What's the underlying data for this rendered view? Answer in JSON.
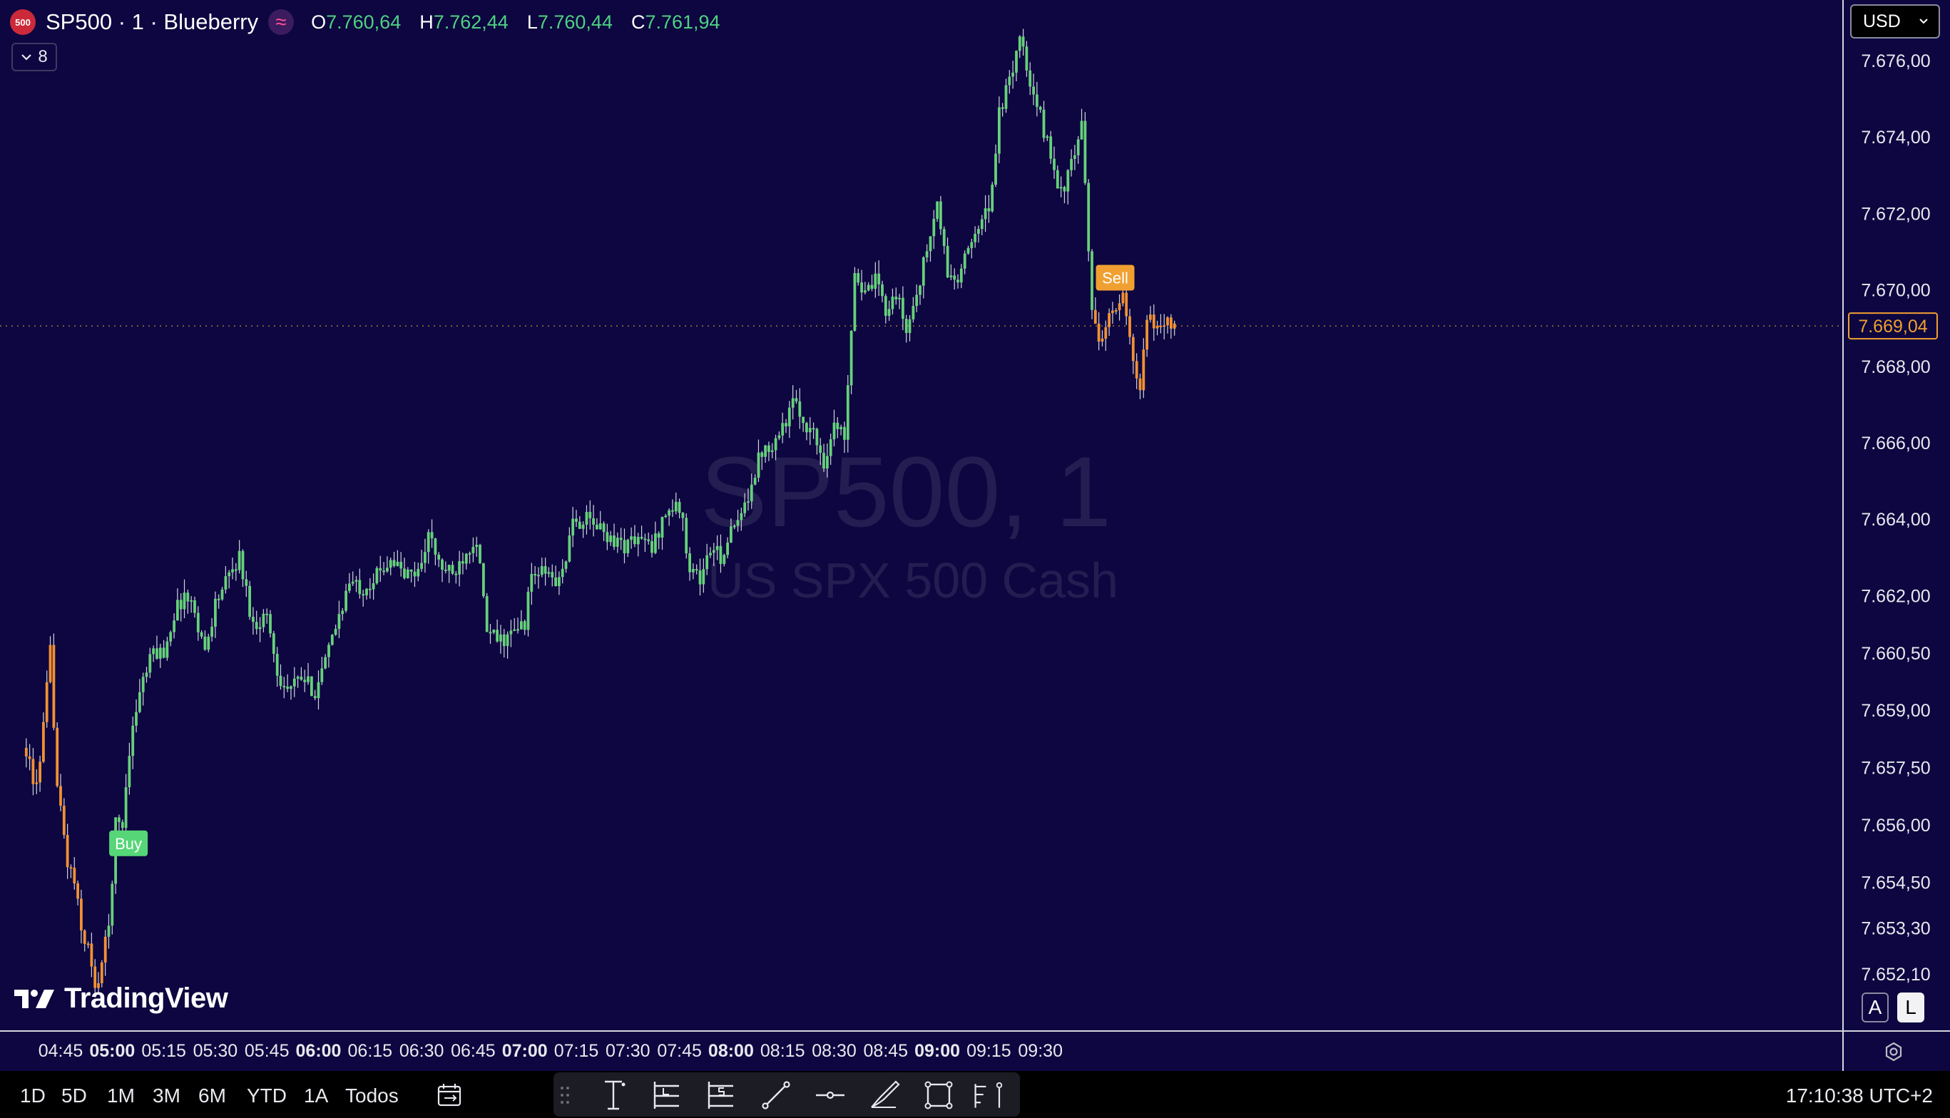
{
  "header": {
    "symbol_logo_text": "500",
    "title": "SP500 · 1 · Blueberry",
    "ohlc": [
      {
        "key": "O",
        "value": "7.760,64"
      },
      {
        "key": "H",
        "value": "7.762,44"
      },
      {
        "key": "L",
        "value": "7.760,44"
      },
      {
        "key": "C",
        "value": "7.761,94"
      }
    ],
    "indicator_count": "8"
  },
  "currency": {
    "label": "USD"
  },
  "watermark": {
    "line1": "SP500, 1",
    "line2": "US SPX 500 Cash"
  },
  "logo": {
    "text": "TradingView"
  },
  "scale_buttons": {
    "auto": "A",
    "log": "L"
  },
  "ranges": [
    "1D",
    "5D",
    "1M",
    "3M",
    "6M",
    "YTD",
    "1A",
    "Todos"
  ],
  "clock": "17:10:38 UTC+2",
  "colors": {
    "background": "#0d0640",
    "up": "#66d17a",
    "down": "#f19133",
    "wick": "#cfd6dd",
    "accent": "#f0a030",
    "buy": "#56d677"
  },
  "tools": [
    "drag-handle-icon",
    "cursor-text-icon",
    "long-position-icon",
    "short-position-icon",
    "trend-line-icon",
    "horizontal-ray-icon",
    "brush-icon",
    "rectangle-icon",
    "fib-icon"
  ],
  "chart_data": {
    "type": "candlestick",
    "x_ticks": [
      {
        "label": "04:45",
        "t": 0,
        "bold": false
      },
      {
        "label": "05:00",
        "t": 15,
        "bold": true
      },
      {
        "label": "05:15",
        "t": 30,
        "bold": false
      },
      {
        "label": "05:30",
        "t": 45,
        "bold": false
      },
      {
        "label": "05:45",
        "t": 60,
        "bold": false
      },
      {
        "label": "06:00",
        "t": 75,
        "bold": true
      },
      {
        "label": "06:15",
        "t": 90,
        "bold": false
      },
      {
        "label": "06:30",
        "t": 105,
        "bold": false
      },
      {
        "label": "06:45",
        "t": 120,
        "bold": false
      },
      {
        "label": "07:00",
        "t": 135,
        "bold": true
      },
      {
        "label": "07:15",
        "t": 150,
        "bold": false
      },
      {
        "label": "07:30",
        "t": 165,
        "bold": false
      },
      {
        "label": "07:45",
        "t": 180,
        "bold": false
      },
      {
        "label": "08:00",
        "t": 195,
        "bold": true
      },
      {
        "label": "08:15",
        "t": 210,
        "bold": false
      },
      {
        "label": "08:30",
        "t": 225,
        "bold": false
      },
      {
        "label": "08:45",
        "t": 240,
        "bold": false
      },
      {
        "label": "09:00",
        "t": 255,
        "bold": true
      },
      {
        "label": "09:15",
        "t": 270,
        "bold": false
      },
      {
        "label": "09:30",
        "t": 285,
        "bold": false
      }
    ],
    "y_ticks": [
      {
        "label": "7.676,00",
        "value": 7676.0
      },
      {
        "label": "7.674,00",
        "value": 7674.0
      },
      {
        "label": "7.672,00",
        "value": 7672.0
      },
      {
        "label": "7.670,00",
        "value": 7670.0
      },
      {
        "label": "7.668,00",
        "value": 7668.0
      },
      {
        "label": "7.666,00",
        "value": 7666.0
      },
      {
        "label": "7.664,00",
        "value": 7664.0
      },
      {
        "label": "7.662,00",
        "value": 7662.0
      },
      {
        "label": "7.660,50",
        "value": 7660.5
      },
      {
        "label": "7.659,00",
        "value": 7659.0
      },
      {
        "label": "7.657,50",
        "value": 7657.5
      },
      {
        "label": "7.656,00",
        "value": 7656.0
      },
      {
        "label": "7.654,50",
        "value": 7654.5
      },
      {
        "label": "7.653,30",
        "value": 7653.3
      },
      {
        "label": "7.652,10",
        "value": 7652.1
      }
    ],
    "last_price": {
      "label": "7.669,04",
      "value": 7669.04
    },
    "close_points": [
      {
        "t": -10,
        "close": 7658.0
      },
      {
        "t": -8,
        "close": 7657.0
      },
      {
        "t": -6,
        "close": 7657.5
      },
      {
        "t": -3,
        "close": 7660.5
      },
      {
        "t": -1,
        "close": 7657.0
      },
      {
        "t": 2,
        "close": 7655.0
      },
      {
        "t": 4,
        "close": 7654.5
      },
      {
        "t": 6,
        "close": 7653.2
      },
      {
        "t": 8,
        "close": 7652.8
      },
      {
        "t": 10,
        "close": 7651.6
      },
      {
        "t": 12,
        "close": 7652.4
      },
      {
        "t": 14,
        "close": 7653.3
      },
      {
        "t": 16,
        "close": 7656.0
      },
      {
        "t": 18,
        "close": 7656.0
      },
      {
        "t": 20,
        "close": 7658.0
      },
      {
        "t": 23,
        "close": 7659.5
      },
      {
        "t": 27,
        "close": 7660.5
      },
      {
        "t": 30,
        "close": 7660.5
      },
      {
        "t": 33,
        "close": 7661.5
      },
      {
        "t": 36,
        "close": 7662.0
      },
      {
        "t": 39,
        "close": 7661.6
      },
      {
        "t": 42,
        "close": 7660.5
      },
      {
        "t": 45,
        "close": 7661.8
      },
      {
        "t": 48,
        "close": 7662.3
      },
      {
        "t": 52,
        "close": 7663.0
      },
      {
        "t": 56,
        "close": 7661.2
      },
      {
        "t": 60,
        "close": 7661.5
      },
      {
        "t": 63,
        "close": 7660.0
      },
      {
        "t": 66,
        "close": 7659.5
      },
      {
        "t": 70,
        "close": 7659.8
      },
      {
        "t": 74,
        "close": 7659.5
      },
      {
        "t": 78,
        "close": 7660.5
      },
      {
        "t": 81,
        "close": 7661.5
      },
      {
        "t": 84,
        "close": 7662.3
      },
      {
        "t": 88,
        "close": 7662.2
      },
      {
        "t": 92,
        "close": 7662.5
      },
      {
        "t": 96,
        "close": 7663.0
      },
      {
        "t": 100,
        "close": 7662.5
      },
      {
        "t": 104,
        "close": 7662.6
      },
      {
        "t": 107,
        "close": 7663.6
      },
      {
        "t": 110,
        "close": 7662.8
      },
      {
        "t": 114,
        "close": 7662.5
      },
      {
        "t": 118,
        "close": 7663.2
      },
      {
        "t": 121,
        "close": 7663.5
      },
      {
        "t": 124,
        "close": 7661.0
      },
      {
        "t": 128,
        "close": 7660.8
      },
      {
        "t": 132,
        "close": 7661.0
      },
      {
        "t": 135,
        "close": 7661.3
      },
      {
        "t": 137,
        "close": 7662.5
      },
      {
        "t": 141,
        "close": 7662.6
      },
      {
        "t": 145,
        "close": 7662.3
      },
      {
        "t": 149,
        "close": 7663.8
      },
      {
        "t": 152,
        "close": 7664.0
      },
      {
        "t": 156,
        "close": 7663.8
      },
      {
        "t": 160,
        "close": 7663.5
      },
      {
        "t": 164,
        "close": 7663.3
      },
      {
        "t": 168,
        "close": 7663.5
      },
      {
        "t": 172,
        "close": 7663.2
      },
      {
        "t": 176,
        "close": 7664.2
      },
      {
        "t": 180,
        "close": 7664.3
      },
      {
        "t": 183,
        "close": 7662.8
      },
      {
        "t": 186,
        "close": 7662.4
      },
      {
        "t": 189,
        "close": 7663.2
      },
      {
        "t": 192,
        "close": 7663.0
      },
      {
        "t": 195,
        "close": 7663.6
      },
      {
        "t": 198,
        "close": 7664.0
      },
      {
        "t": 201,
        "close": 7665.0
      },
      {
        "t": 204,
        "close": 7665.8
      },
      {
        "t": 207,
        "close": 7666.0
      },
      {
        "t": 210,
        "close": 7666.4
      },
      {
        "t": 213,
        "close": 7667.0
      },
      {
        "t": 216,
        "close": 7666.6
      },
      {
        "t": 219,
        "close": 7666.2
      },
      {
        "t": 222,
        "close": 7665.5
      },
      {
        "t": 225,
        "close": 7666.4
      },
      {
        "t": 228,
        "close": 7666.2
      },
      {
        "t": 231,
        "close": 7670.5
      },
      {
        "t": 234,
        "close": 7669.8
      },
      {
        "t": 237,
        "close": 7670.2
      },
      {
        "t": 240,
        "close": 7669.5
      },
      {
        "t": 243,
        "close": 7669.9
      },
      {
        "t": 246,
        "close": 7668.9
      },
      {
        "t": 249,
        "close": 7669.9
      },
      {
        "t": 252,
        "close": 7671.0
      },
      {
        "t": 255,
        "close": 7672.2
      },
      {
        "t": 258,
        "close": 7670.4
      },
      {
        "t": 261,
        "close": 7670.2
      },
      {
        "t": 264,
        "close": 7671.0
      },
      {
        "t": 267,
        "close": 7671.8
      },
      {
        "t": 270,
        "close": 7672.0
      },
      {
        "t": 273,
        "close": 7674.6
      },
      {
        "t": 276,
        "close": 7675.4
      },
      {
        "t": 279,
        "close": 7676.7
      },
      {
        "t": 282,
        "close": 7675.2
      },
      {
        "t": 285,
        "close": 7674.5
      },
      {
        "t": 288,
        "close": 7673.5
      },
      {
        "t": 291,
        "close": 7672.5
      },
      {
        "t": 294,
        "close": 7673.2
      },
      {
        "t": 297,
        "close": 7674.2
      },
      {
        "t": 300,
        "close": 7669.5
      },
      {
        "t": 303,
        "close": 7668.5
      },
      {
        "t": 306,
        "close": 7669.6
      },
      {
        "t": 309,
        "close": 7669.8
      },
      {
        "t": 312,
        "close": 7668.0
      },
      {
        "t": 314,
        "close": 7667.3
      },
      {
        "t": 316,
        "close": 7669.2
      },
      {
        "t": 319,
        "close": 7669.0
      },
      {
        "t": 322,
        "close": 7669.2
      },
      {
        "t": 324,
        "close": 7669.04
      }
    ],
    "markers": [
      {
        "label": "Buy",
        "t": 16,
        "price": 7655.5,
        "color": "#56d677"
      },
      {
        "label": "Sell",
        "t": 303,
        "price": 7670.3,
        "color": "#f0a030"
      }
    ]
  }
}
